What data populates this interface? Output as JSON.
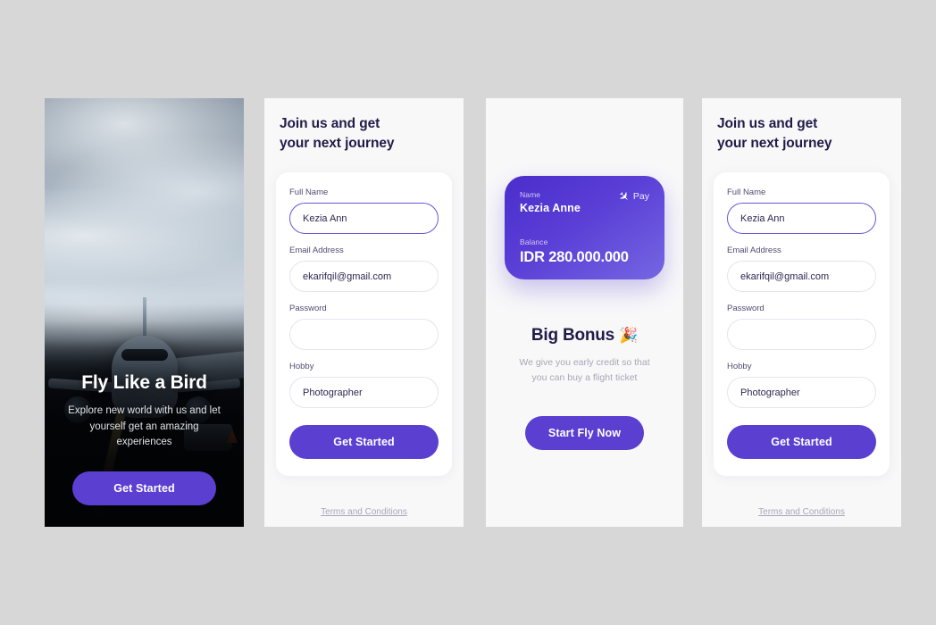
{
  "theme": {
    "page_background": "#d7d7d7",
    "screen_background": "#f8f8f9",
    "accent_purple": "#5b3fd1",
    "card_gradient_from": "#4b2ecb",
    "card_gradient_to": "#7567e2",
    "heading_color": "#211b47",
    "muted_text": "#a9a6b8"
  },
  "screens": {
    "onboarding": {
      "name": "onboarding",
      "photo_alt": "airplane-on-tarmac-photo",
      "title": "Fly Like a Bird",
      "subtitle": "Explore new world with us and let yourself get an amazing experiences",
      "cta_label": "Get Started"
    },
    "signup_a": {
      "name": "signup-form",
      "heading_line1": "Join us and get",
      "heading_line2": "your next journey",
      "fields": [
        {
          "label": "Full Name",
          "value": "Kezia Ann",
          "placeholder": "Full Name",
          "focused": true,
          "type": "text"
        },
        {
          "label": "Email Address",
          "value": "ekarifqil@gmail.com",
          "placeholder": "Email Address",
          "focused": false,
          "type": "email"
        },
        {
          "label": "Password",
          "value": "",
          "placeholder": "",
          "focused": false,
          "type": "password"
        },
        {
          "label": "Hobby",
          "value": "Photographer",
          "placeholder": "Hobby",
          "focused": false,
          "type": "text"
        }
      ],
      "cta_label": "Get Started",
      "terms_label": "Terms and Conditions"
    },
    "bonus": {
      "name": "big-bonus",
      "card": {
        "name_label": "Name",
        "name_value": "Kezia Anne",
        "pay_label": "Pay",
        "pay_icon": "airplane-icon",
        "balance_label": "Balance",
        "balance_value": "IDR 280.000.000"
      },
      "title": "Big Bonus",
      "title_emoji": "🎉",
      "subtitle_line1": "We give you early credit so that",
      "subtitle_line2": "you can buy a flight ticket",
      "cta_label": "Start Fly Now"
    },
    "signup_b": {
      "name": "signup-form-duplicate",
      "heading_line1": "Join us and get",
      "heading_line2": "your next journey",
      "fields": [
        {
          "label": "Full Name",
          "value": "Kezia Ann",
          "placeholder": "Full Name",
          "focused": true,
          "type": "text"
        },
        {
          "label": "Email Address",
          "value": "ekarifqil@gmail.com",
          "placeholder": "Email Address",
          "focused": false,
          "type": "email"
        },
        {
          "label": "Password",
          "value": "",
          "placeholder": "",
          "focused": false,
          "type": "password"
        },
        {
          "label": "Hobby",
          "value": "Photographer",
          "placeholder": "Hobby",
          "focused": false,
          "type": "text"
        }
      ],
      "cta_label": "Get Started",
      "terms_label": "Terms and Conditions"
    }
  }
}
